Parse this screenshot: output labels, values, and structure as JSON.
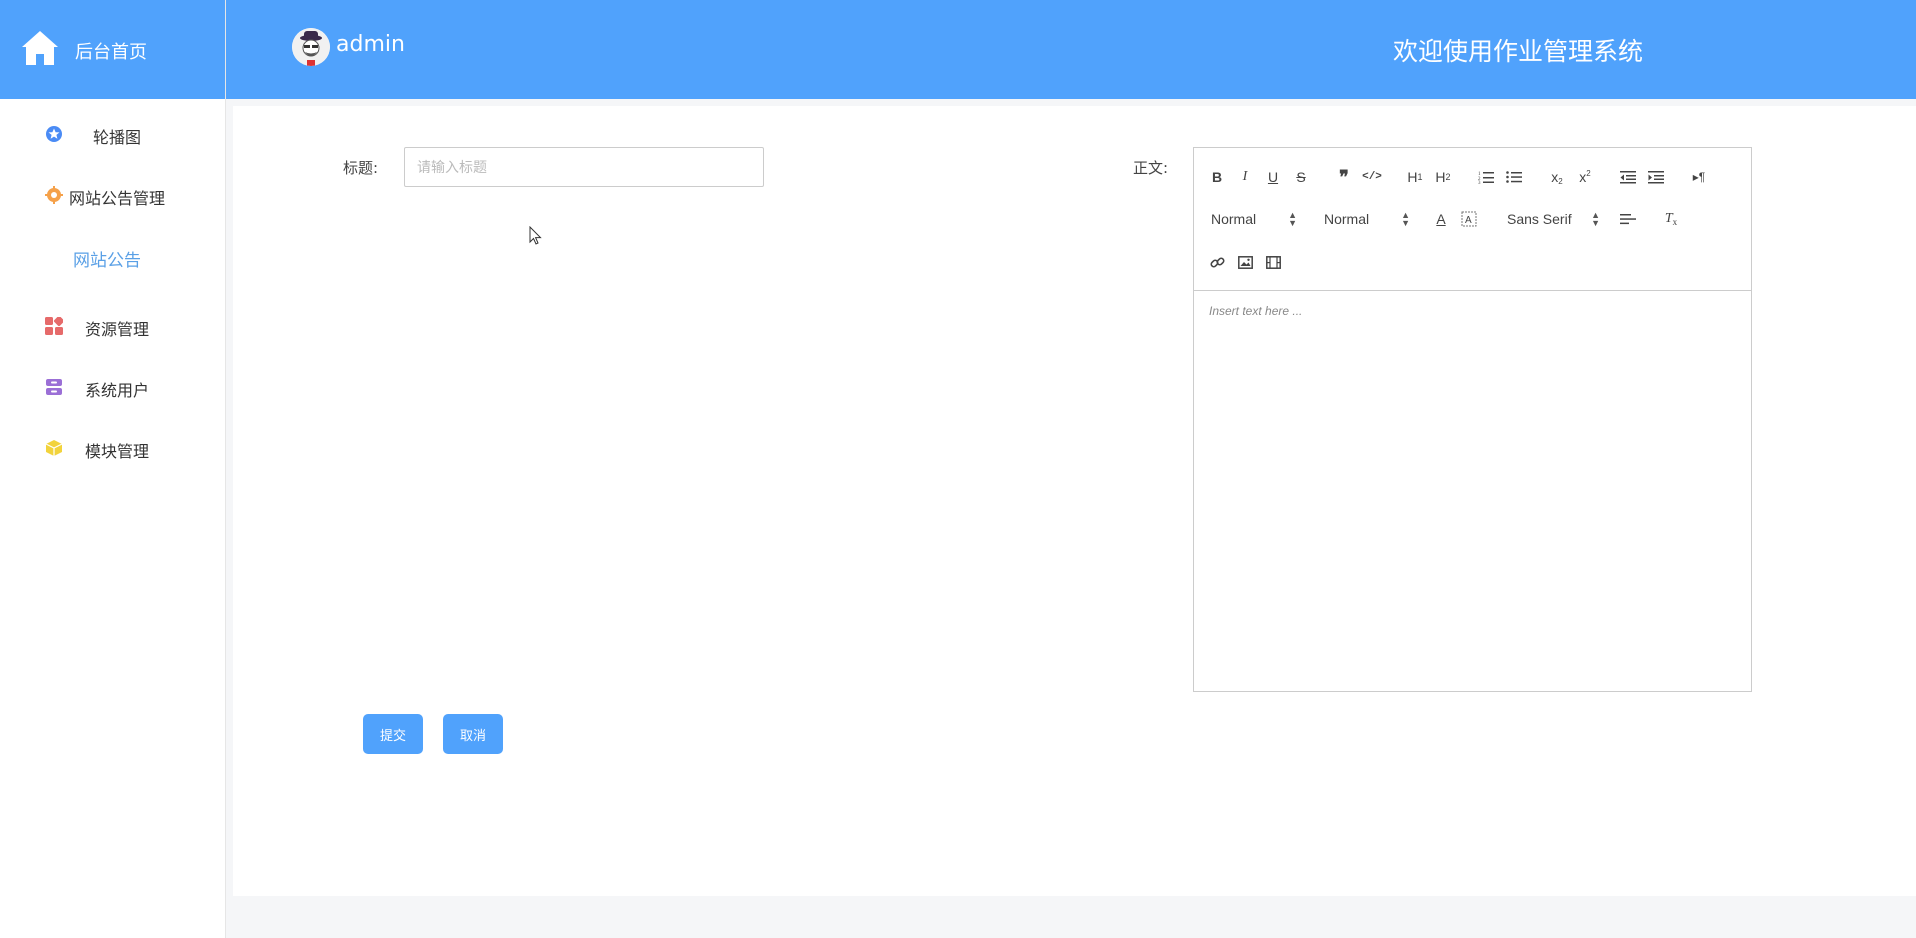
{
  "sidebar": {
    "brand_label": "后台首页",
    "items": [
      {
        "label": "轮播图",
        "icon": "star-badge-icon",
        "color": "#4a8bf5"
      },
      {
        "label": "网站公告管理",
        "icon": "gear-icon",
        "color": "#f5a14a"
      },
      {
        "label": "网站公告",
        "sub": true
      },
      {
        "label": "资源管理",
        "icon": "grid-icon",
        "color": "#e66a6a"
      },
      {
        "label": "系统用户",
        "icon": "archive-icon",
        "color": "#9b6fd6"
      },
      {
        "label": "模块管理",
        "icon": "cube-icon",
        "color": "#f2d33c"
      }
    ]
  },
  "header": {
    "username": "admin",
    "welcome": "欢迎使用作业管理系统",
    "accent": "#50a2fc"
  },
  "form": {
    "title_label": "标题:",
    "title_value": "",
    "title_placeholder": "请输入标题",
    "body_label": "正文:",
    "editor": {
      "header_select": "Normal",
      "size_select": "Normal",
      "font_select": "Sans Serif",
      "placeholder": "Insert text here ..."
    },
    "submit_label": "提交",
    "cancel_label": "取消"
  }
}
